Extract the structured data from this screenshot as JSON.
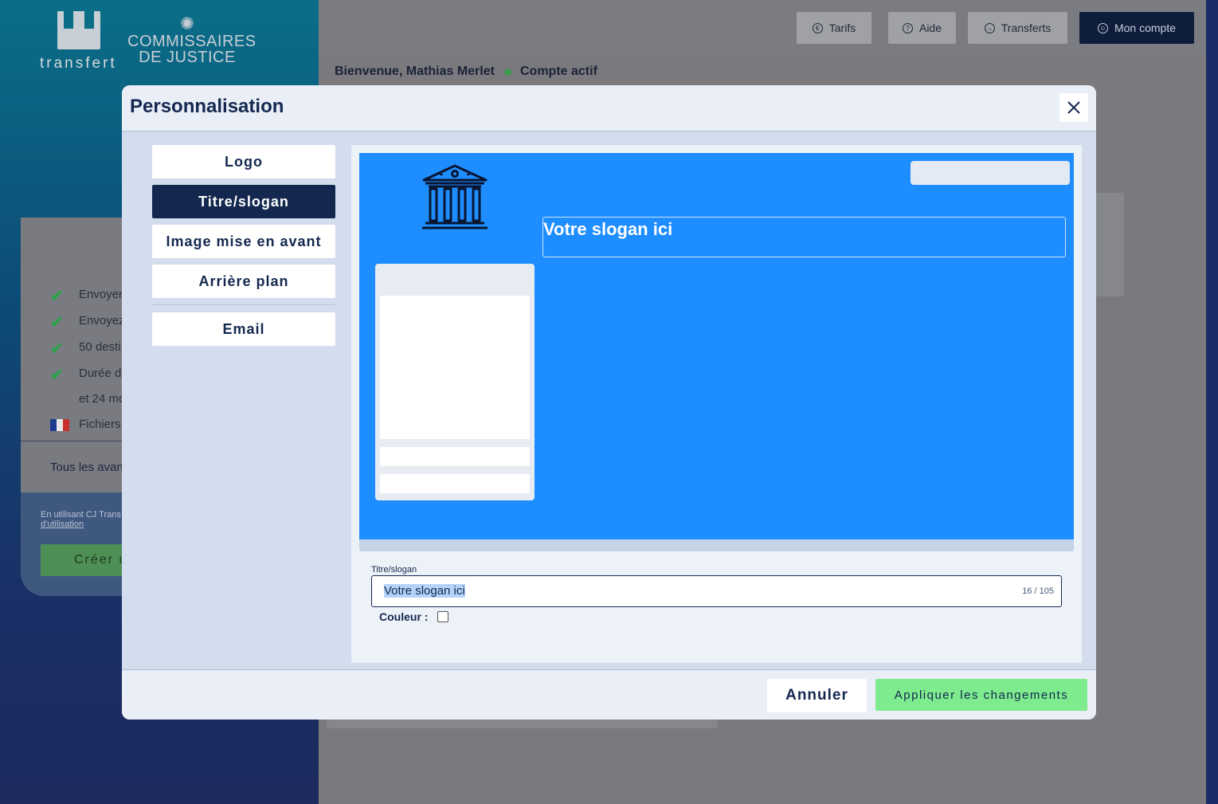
{
  "brand": {
    "logo_text": "transfert",
    "partner_line1": "COMMISSAIRES",
    "partner_line2": "DE JUSTICE"
  },
  "topbar": {
    "buttons": [
      {
        "label": "Tarifs",
        "icon": "euro-icon"
      },
      {
        "label": "Aide",
        "icon": "help-icon"
      },
      {
        "label": "Transferts",
        "icon": "transfer-icon"
      },
      {
        "label": "Mon compte",
        "icon": "account-icon"
      }
    ],
    "welcome": "Bienvenue, Mathias Merlet",
    "status": "Compte actif",
    "status_color": "#3f9a50"
  },
  "plan": {
    "features": [
      "Envoyer",
      "Envoyez",
      "50 desti",
      "Durée d",
      "et 24 mo",
      "Fichiers"
    ],
    "all_advantages": "Tous les avan",
    "terms_line1": "En utilisant CJ Trans",
    "terms_line2": "d'utilisation",
    "create_label": "Créer u"
  },
  "modal": {
    "title": "Personnalisation",
    "tabs": [
      {
        "label": "Logo",
        "active": false
      },
      {
        "label": "Titre/slogan",
        "active": true
      },
      {
        "label": "Image mise en avant",
        "active": false
      },
      {
        "label": "Arrière plan",
        "active": false
      },
      {
        "label": "Email",
        "active": false
      }
    ],
    "preview": {
      "slogan": "Votre slogan ici",
      "background_color": "#1e8dff"
    },
    "field": {
      "label": "Titre/slogan",
      "value": "Votre slogan ici",
      "counter": "16 / 105"
    },
    "color_label": "Couleur :",
    "cancel_label": "Annuler",
    "apply_label": "Appliquer les changements"
  }
}
